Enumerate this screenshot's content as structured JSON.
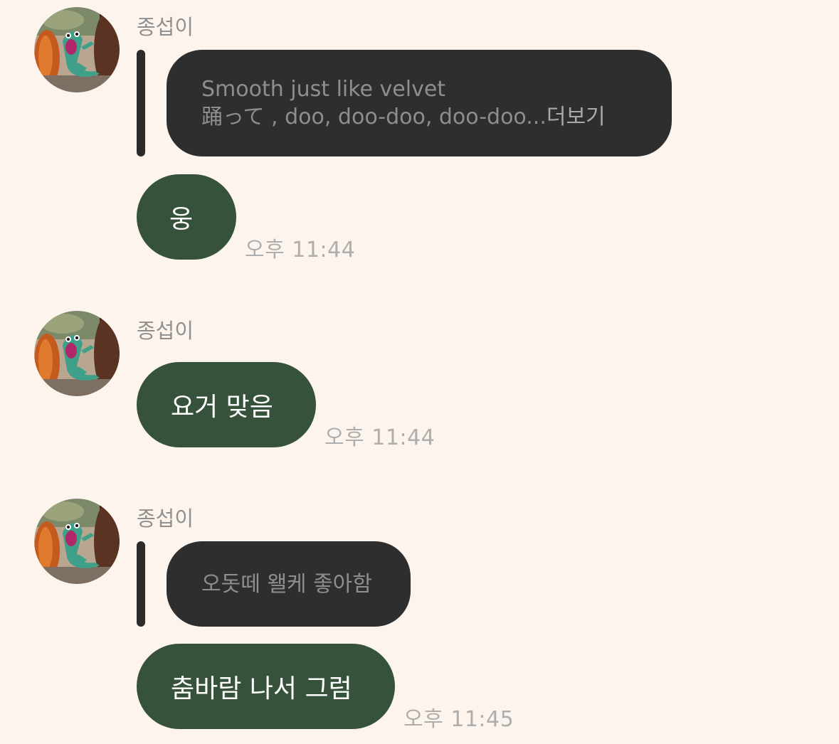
{
  "messages": [
    {
      "sender": "종섭이",
      "reply": {
        "line1": "Smooth just like velvet",
        "line2": "踊って , doo, doo-doo, doo-doo...",
        "more_label": "더보기"
      },
      "text": "웅",
      "time": "오후 11:44"
    },
    {
      "sender": "종섭이",
      "text": "요거 맞음",
      "time": "오후 11:44"
    },
    {
      "sender": "종섭이",
      "reply": {
        "line1": "오돗떼 왤케 좋아함"
      },
      "text": "춤바람 나서 그럼",
      "time": "오후 11:45"
    }
  ],
  "colors": {
    "background": "#fdf5ed",
    "reply_bubble": "#2e2e2e",
    "reply_bar": "#2b2b2b",
    "message_bubble": "#36523b",
    "muted_text": "#8f8f8f"
  },
  "icons": {
    "avatar": "profile-avatar-lizard"
  }
}
